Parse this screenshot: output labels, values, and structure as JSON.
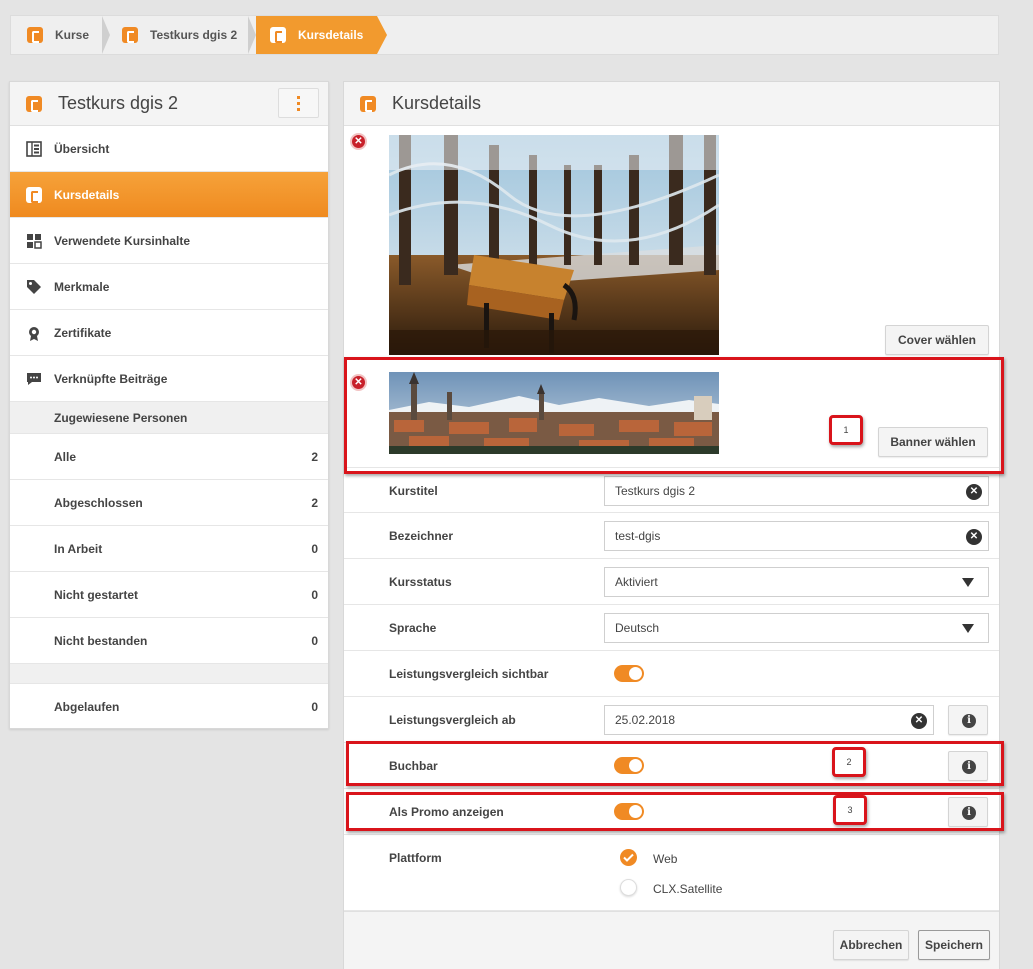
{
  "breadcrumb": {
    "items": [
      "Kurse",
      "Testkurs dgis 2",
      "Kursdetails"
    ]
  },
  "sidebar": {
    "title": "Testkurs dgis 2",
    "items": [
      {
        "label": "Übersicht",
        "icon": "overview-icon"
      },
      {
        "label": "Kursdetails",
        "icon": "course-icon"
      },
      {
        "label": "Verwendete Kursinhalte",
        "icon": "content-icon"
      },
      {
        "label": "Merkmale",
        "icon": "tag-icon"
      },
      {
        "label": "Zertifikate",
        "icon": "certificate-icon"
      },
      {
        "label": "Verknüpfte Beiträge",
        "icon": "comment-icon"
      }
    ],
    "section_title": "Zugewiesene Personen",
    "counts": [
      {
        "label": "Alle",
        "value": "2"
      },
      {
        "label": "Abgeschlossen",
        "value": "2"
      },
      {
        "label": "In Arbeit",
        "value": "0"
      },
      {
        "label": "Nicht gestartet",
        "value": "0"
      },
      {
        "label": "Nicht bestanden",
        "value": "0"
      }
    ],
    "expired": {
      "label": "Abgelaufen",
      "value": "0"
    }
  },
  "main": {
    "title": "Kursdetails",
    "cover_button": "Cover wählen",
    "banner_button": "Banner wählen",
    "fields": {
      "kurstitel": {
        "label": "Kurstitel",
        "value": "Testkurs dgis 2"
      },
      "bezeichner": {
        "label": "Bezeichner",
        "value": "test-dgis"
      },
      "kursstatus": {
        "label": "Kursstatus",
        "value": "Aktiviert"
      },
      "sprache": {
        "label": "Sprache",
        "value": "Deutsch"
      },
      "leistung_sichtbar": {
        "label": "Leistungsvergleich sichtbar",
        "on": true
      },
      "leistung_ab": {
        "label": "Leistungsvergleich ab",
        "value": "25.02.2018"
      },
      "buchbar": {
        "label": "Buchbar",
        "on": true
      },
      "promo": {
        "label": "Als Promo anzeigen",
        "on": true
      },
      "plattform": {
        "label": "Plattform",
        "options": [
          {
            "label": "Web",
            "checked": true
          },
          {
            "label": "CLX.Satellite",
            "checked": false
          }
        ]
      }
    },
    "cancel_button": "Abbrechen",
    "save_button": "Speichern"
  },
  "annotations": [
    "1",
    "2",
    "3"
  ],
  "colors": {
    "accent": "#f08a24",
    "highlight": "#d9141b",
    "delete": "#c8202a"
  }
}
